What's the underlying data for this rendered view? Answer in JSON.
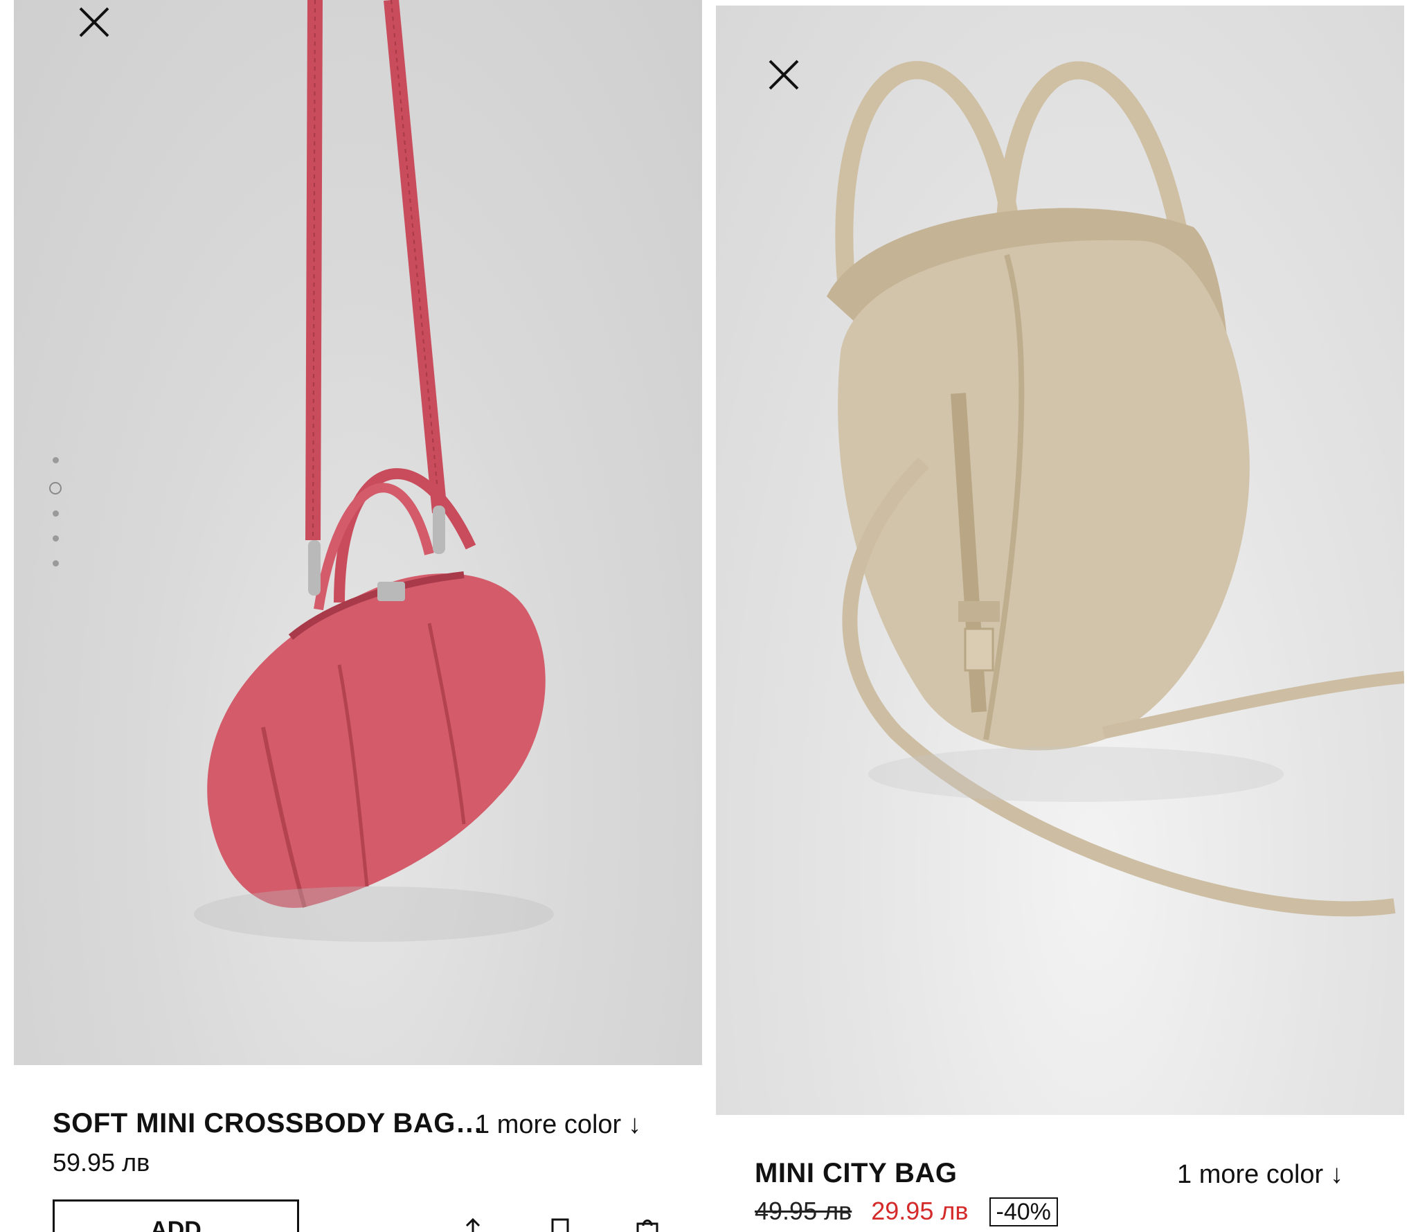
{
  "products": [
    {
      "name": "SOFT MINI CROSSBODY BAG…",
      "more_colors": "1 more color",
      "price": "59.95 лв",
      "add_label": "ADD",
      "image_dots": 5,
      "active_dot": 2,
      "bag_color": "#d35b6a"
    },
    {
      "name": "MINI CITY BAG",
      "more_colors": "1 more color",
      "old_price": "49.95 лв",
      "sale_price": "29.95 лв",
      "discount": "-40%",
      "bag_color": "#d2c4aa"
    }
  ],
  "icons": {
    "close": "close-icon",
    "more_arrow": "arrow-down-icon",
    "share": "share-icon",
    "bookmark": "bookmark-icon",
    "bag": "shopping-bag-icon"
  },
  "colors": {
    "sale": "#d42a2a",
    "text": "#111111"
  }
}
